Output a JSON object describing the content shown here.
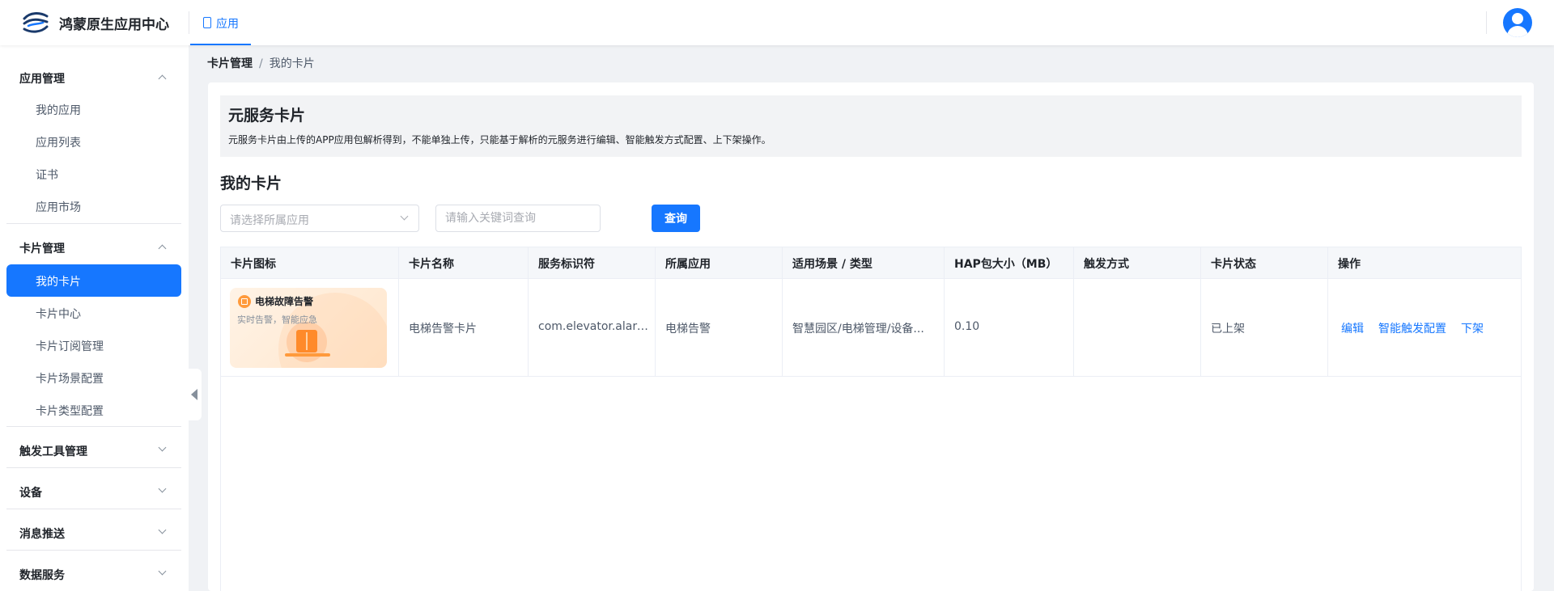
{
  "header": {
    "app_name": "鸿蒙原生应用中心",
    "tab_label": "应用"
  },
  "sidebar": {
    "groups": [
      {
        "label": "应用管理",
        "expanded": true,
        "items": [
          "我的应用",
          "应用列表",
          "证书",
          "应用市场"
        ]
      },
      {
        "label": "卡片管理",
        "expanded": true,
        "items": [
          "我的卡片",
          "卡片中心",
          "卡片订阅管理",
          "卡片场景配置",
          "卡片类型配置"
        ],
        "active": "我的卡片"
      },
      {
        "label": "触发工具管理",
        "expanded": false
      },
      {
        "label": "设备",
        "expanded": false
      },
      {
        "label": "消息推送",
        "expanded": false
      },
      {
        "label": "数据服务",
        "expanded": false
      }
    ]
  },
  "breadcrumb": {
    "parent": "卡片管理",
    "separator": "/",
    "current": "我的卡片"
  },
  "banner": {
    "title": "元服务卡片",
    "description": "元服务卡片由上传的APP应用包解析得到，不能单独上传，只能基于解析的元服务进行编辑、智能触发方式配置、上下架操作。"
  },
  "section_title": "我的卡片",
  "filters": {
    "app_select_placeholder": "请选择所属应用",
    "keyword_placeholder": "请输入关键词查询",
    "query_label": "查询"
  },
  "table": {
    "columns": [
      "卡片图标",
      "卡片名称",
      "服务标识符",
      "所属应用",
      "适用场景 / 类型",
      "HAP包大小（MB）",
      "触发方式",
      "卡片状态",
      "操作"
    ],
    "rows": [
      {
        "thumb_title": "电梯故障告警",
        "thumb_subtitle": "实时告警，智能应急",
        "name": "电梯告警卡片",
        "service_id": "com.elevator.alarm...",
        "app": "电梯告警",
        "scene": "智慧园区/电梯管理/设备...",
        "hap_size": "0.10",
        "trigger": "",
        "status": "已上架",
        "actions": [
          "编辑",
          "智能触发配置",
          "下架"
        ]
      }
    ]
  },
  "colors": {
    "primary": "#1677ff",
    "text": "#1f2329",
    "muted": "#4e5969",
    "banner_bg": "#f2f3f5"
  }
}
